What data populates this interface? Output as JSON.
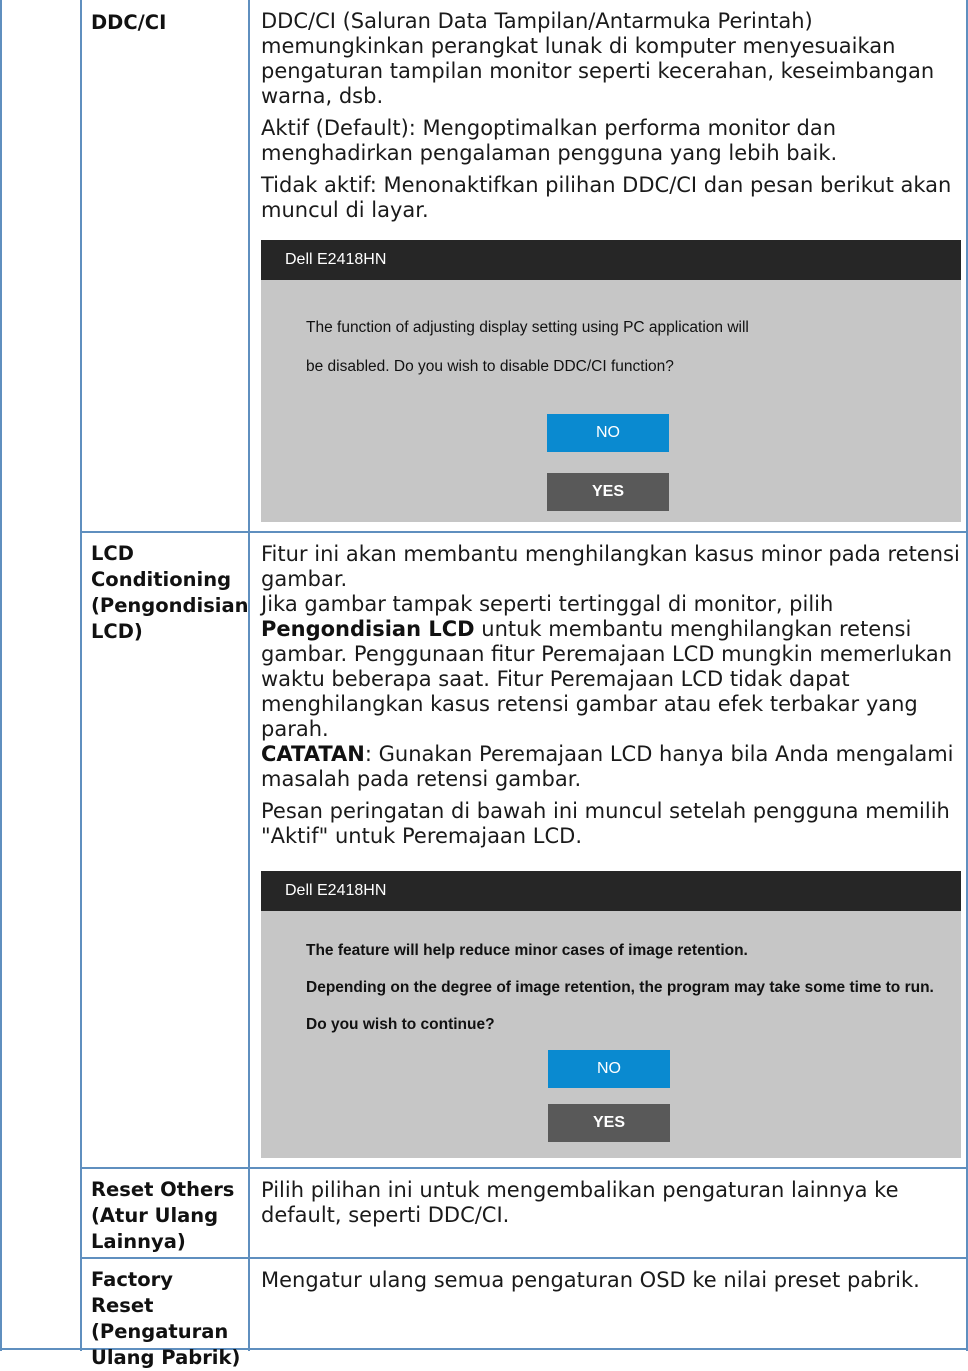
{
  "rows": {
    "ddc": {
      "label": "DDC/CI",
      "para1": "DDC/CI (Saluran Data Tampilan/Antarmuka Perintah) memungkinkan perangkat lunak di komputer menyesuaikan pengaturan tampilan monitor seperti kecerahan, keseimbangan warna, dsb.",
      "para2": "Aktif (Default): Mengoptimalkan performa monitor dan menghadirkan pengalaman pengguna yang lebih baik.",
      "para3": "Tidak aktif: Menonaktifkan pilihan DDC/CI dan pesan berikut akan muncul di layar.",
      "osd": {
        "title": "Dell E2418HN",
        "line1": "The function of adjusting display setting using PC application will",
        "line2": "be disabled. Do you wish to disable DDC/CI function?",
        "no": "NO",
        "yes": "YES"
      }
    },
    "lcd": {
      "label_line1": "LCD",
      "label_line2": "Conditioning",
      "label_line3": "(Pengondisian",
      "label_line4": "LCD)",
      "para1": "Fitur ini akan membantu menghilangkan kasus minor pada retensi gambar.",
      "para2_pre": "Jika gambar tampak seperti tertinggal di monitor, pilih ",
      "para2_bold": "Pengondisian LCD",
      "para2_post": " untuk membantu menghilangkan retensi gambar. Penggunaan fitur Peremajaan LCD mungkin memerlukan waktu beberapa saat. Fitur Peremajaan LCD tidak dapat menghilangkan kasus retensi gambar atau efek terbakar yang parah.",
      "note_bold": "CATATAN",
      "note_text": ": Gunakan Peremajaan LCD hanya bila Anda mengalami masalah pada retensi gambar.",
      "para3": "Pesan peringatan di bawah ini muncul setelah pengguna memilih \"Aktif\" untuk Peremajaan LCD.",
      "osd": {
        "title": "Dell E2418HN",
        "line1": "The feature will help reduce minor cases of image retention.",
        "line2": "Depending on the degree of image retention, the program may take some time to run.",
        "line3": "Do you wish to continue?",
        "no": "NO",
        "yes": "YES"
      }
    },
    "reset_others": {
      "label_line1": "Reset Others",
      "label_line2": "(Atur Ulang",
      "label_line3": "Lainnya)",
      "desc": "Pilih pilihan ini untuk mengembalikan pengaturan lainnya ke default, seperti DDC/CI."
    },
    "factory_reset": {
      "label_line1": "Factory Reset",
      "label_line2": "(Pengaturan",
      "label_line3": "Ulang Pabrik)",
      "desc": "Mengatur ulang semua pengaturan OSD ke nilai preset pabrik."
    }
  },
  "colors": {
    "grid": "#5f8fbf",
    "osd_title_bg": "#262626",
    "osd_body_bg": "#c6c6c6",
    "btn_no": "#0a8ad0",
    "btn_yes": "#595959"
  }
}
